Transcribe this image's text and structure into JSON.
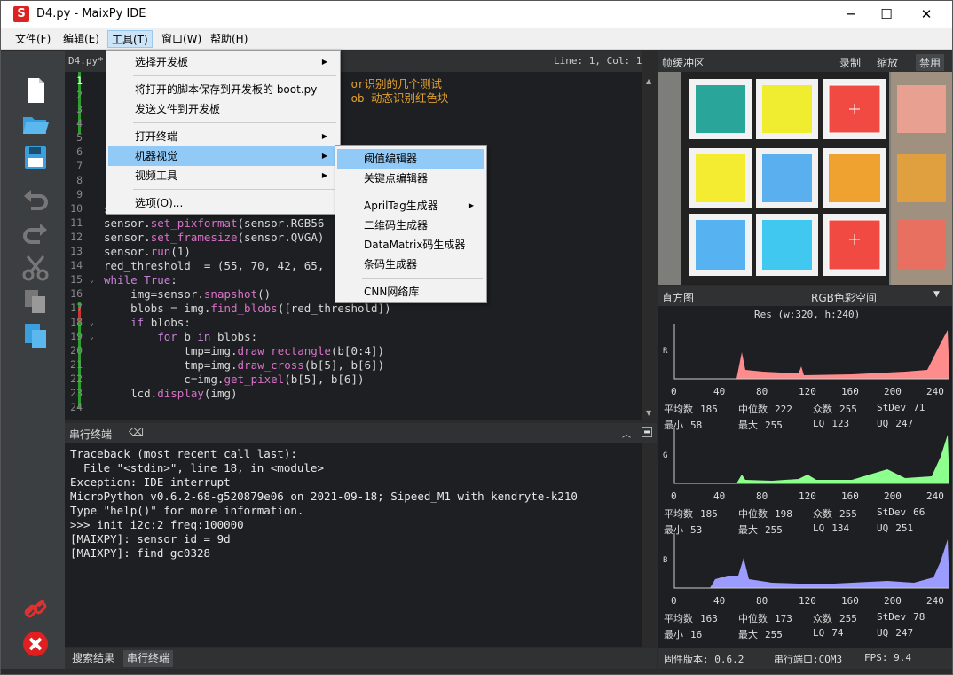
{
  "window": {
    "title": "D4.py - MaixPy IDE",
    "min": "─",
    "max": "☐",
    "close": "✕"
  },
  "menubar": [
    "文件(F)",
    "编辑(E)",
    "工具(T)",
    "窗口(W)",
    "帮助(H)"
  ],
  "editor": {
    "tab": "D4.py*",
    "position": "Line: 1, Col: 1",
    "lines": [
      {
        "n": "1",
        "html": "<span class='cm'>                                     or识别的几个测试</span>"
      },
      {
        "n": "2",
        "html": "<span class='cm'>                                     ob 动态识别红色块</span>"
      },
      {
        "n": "3",
        "html": ""
      },
      {
        "n": "4",
        "html": ""
      },
      {
        "n": "5",
        "html": ""
      },
      {
        "n": "6",
        "html": ""
      },
      {
        "n": "7",
        "html": ""
      },
      {
        "n": "8",
        "html": ""
      },
      {
        "n": "9",
        "html": ""
      },
      {
        "n": "10",
        "html": "sensor.reset()"
      },
      {
        "n": "11",
        "html": "sensor.<span class='mth'>set_pixformat</span>(sensor.RGB56"
      },
      {
        "n": "12",
        "html": "sensor.<span class='mth'>set_framesize</span>(sensor.QVGA)"
      },
      {
        "n": "13",
        "html": "sensor.<span class='mth'>run</span>(1)"
      },
      {
        "n": "14",
        "html": "red_threshold  = (55, 70, 42, 65,"
      },
      {
        "n": "15",
        "html": "<span class='kw'>while</span> <span class='kw'>True</span>:"
      },
      {
        "n": "16",
        "html": "    img=sensor.<span class='mth'>snapshot</span>()"
      },
      {
        "n": "17",
        "html": "    blobs = img.<span class='mth'>find_blobs</span>([red_threshold])"
      },
      {
        "n": "18",
        "html": "    <span class='kw'>if</span> blobs:"
      },
      {
        "n": "19",
        "html": "        <span class='kw'>for</span> b <span class='kw'>in</span> blobs:"
      },
      {
        "n": "20",
        "html": "            tmp=img.<span class='mth'>draw_rectangle</span>(b[0:4])"
      },
      {
        "n": "21",
        "html": "            tmp=img.<span class='mth'>draw_cross</span>(b[5], b[6])"
      },
      {
        "n": "22",
        "html": "            c=img.<span class='mth'>get_pixel</span>(b[5], b[6])"
      },
      {
        "n": "23",
        "html": "    lcd.<span class='mth'>display</span>(img)"
      },
      {
        "n": "24",
        "html": ""
      }
    ]
  },
  "tools_menu": [
    "选择开发板",
    "将打开的脚本保存到开发板的 boot.py",
    "发送文件到开发板",
    "打开终端",
    "机器视觉",
    "视频工具",
    "选项(O)..."
  ],
  "vision_menu": [
    "阈值编辑器",
    "关键点编辑器",
    "AprilTag生成器",
    "二维码生成器",
    "DataMatrix码生成器",
    "条码生成器",
    "CNN网络库"
  ],
  "terminal": {
    "title": "串行终端",
    "text": "Traceback (most recent call last):\n  File \"<stdin>\", line 18, in <module>\nException: IDE interrupt\nMicroPython v0.6.2-68-g520879e06 on 2021-09-18; Sipeed_M1 with kendryte-k210\nType \"help()\" for more information.\n>>> init i2c:2 freq:100000\n[MAIXPY]: sensor id = 9d\n[MAIXPY]: find gc0328"
  },
  "bottom_tabs": [
    "搜索结果",
    "串行终端"
  ],
  "framebuffer": {
    "title": "帧缓冲区",
    "buttons": [
      "录制",
      "缩放",
      "禁用"
    ]
  },
  "histogram": {
    "title": "直方图",
    "colorspace": "RGB色彩空间",
    "res": "Res (w:320, h:240)",
    "xticks": [
      "0",
      "40",
      "80",
      "120",
      "160",
      "200",
      "240"
    ],
    "channels": [
      {
        "axis": "R",
        "color": "#ff8c8c",
        "stats1": [
          [
            "平均数",
            "185"
          ],
          [
            "中位数",
            "222"
          ],
          [
            "众数",
            "255"
          ],
          [
            "StDev",
            "71"
          ]
        ],
        "stats2": [
          [
            "最小",
            "58"
          ],
          [
            "最大",
            "255"
          ],
          [
            "LQ",
            "123"
          ],
          [
            "UQ",
            "247"
          ]
        ]
      },
      {
        "axis": "G",
        "color": "#8cff8c",
        "stats1": [
          [
            "平均数",
            "185"
          ],
          [
            "中位数",
            "198"
          ],
          [
            "众数",
            "255"
          ],
          [
            "StDev",
            "66"
          ]
        ],
        "stats2": [
          [
            "最小",
            "53"
          ],
          [
            "最大",
            "255"
          ],
          [
            "LQ",
            "134"
          ],
          [
            "UQ",
            "251"
          ]
        ]
      },
      {
        "axis": "B",
        "color": "#9c9cff",
        "stats1": [
          [
            "平均数",
            "163"
          ],
          [
            "中位数",
            "173"
          ],
          [
            "众数",
            "255"
          ],
          [
            "StDev",
            "78"
          ]
        ],
        "stats2": [
          [
            "最小",
            "16"
          ],
          [
            "最大",
            "255"
          ],
          [
            "LQ",
            "74"
          ],
          [
            "UQ",
            "247"
          ]
        ]
      }
    ]
  },
  "status": {
    "firmware_label": "固件版本:",
    "firmware": "0.6.2",
    "port_label": "串行端口:",
    "port": "COM3",
    "fps_label": "FPS:",
    "fps": "9.4"
  }
}
